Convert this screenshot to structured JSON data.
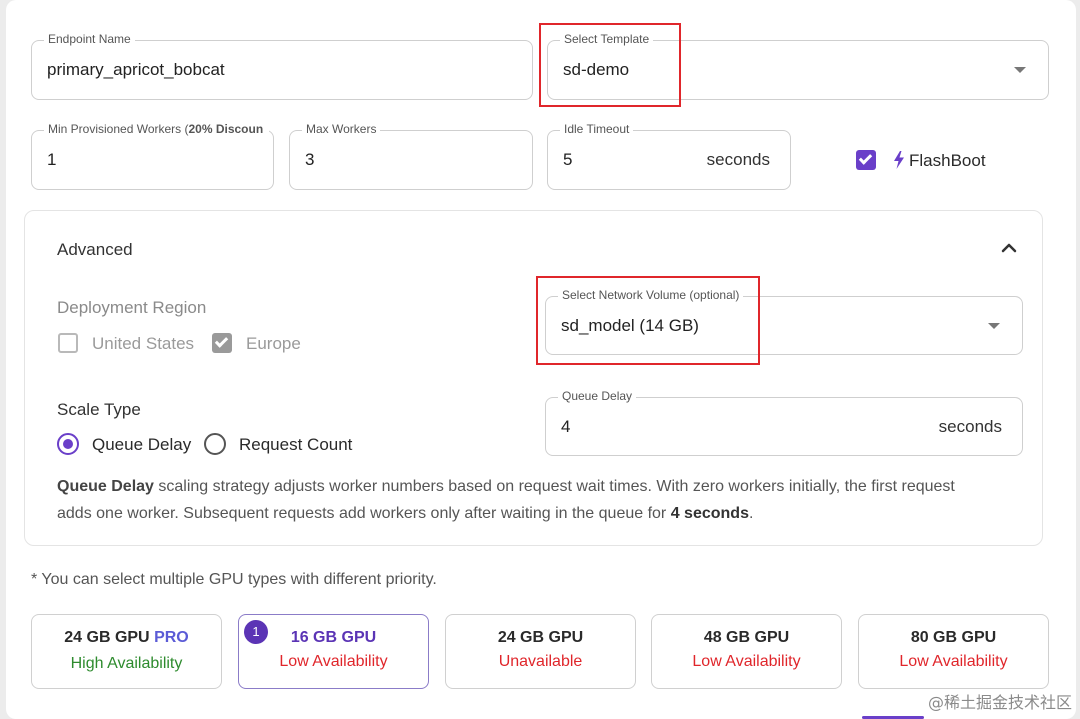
{
  "endpoint_name": {
    "label": "Endpoint Name",
    "value": "primary_apricot_bobcat"
  },
  "template": {
    "label": "Select Template",
    "value": "sd-demo"
  },
  "min_workers": {
    "label_prefix": "Min Provisioned Workers (",
    "label_bold": "20% Discoun",
    "value": "1"
  },
  "max_workers": {
    "label": "Max Workers",
    "value": "3"
  },
  "idle_timeout": {
    "label": "Idle Timeout",
    "value": "5",
    "unit": "seconds"
  },
  "flashboot": {
    "label": "FlashBoot",
    "checked": true,
    "icon": "lightning-icon"
  },
  "advanced": {
    "title": "Advanced",
    "deployment_region": {
      "label": "Deployment Region",
      "options": [
        {
          "label": "United States",
          "checked": false
        },
        {
          "label": "Europe",
          "checked": true
        }
      ]
    },
    "network_volume": {
      "label": "Select Network Volume (optional)",
      "value": "sd_model (14 GB)"
    },
    "scale_type": {
      "label": "Scale Type",
      "options": [
        {
          "label": "Queue Delay",
          "selected": true
        },
        {
          "label": "Request Count",
          "selected": false
        }
      ]
    },
    "queue_delay": {
      "label": "Queue Delay",
      "value": "4",
      "unit": "seconds"
    },
    "description": {
      "strong1": "Queue Delay",
      "text1": " scaling strategy adjusts worker numbers based on request wait times. With zero workers initially, the first request",
      "text2": "adds one worker. Subsequent requests add workers only after waiting in the queue for ",
      "strong2": "4 seconds",
      "text3": "."
    }
  },
  "gpu_note": "* You can select multiple GPU types with different priority.",
  "gpus": [
    {
      "title": "24 GB GPU",
      "badge_text": "PRO",
      "availability": "High Availability",
      "status": "high"
    },
    {
      "title": "16 GB GPU",
      "priority": "1",
      "availability": "Low Availability",
      "status": "low",
      "selected": true
    },
    {
      "title": "24 GB GPU",
      "availability": "Unavailable",
      "status": "unavailable"
    },
    {
      "title": "48 GB GPU",
      "availability": "Low Availability",
      "status": "low"
    },
    {
      "title": "80 GB GPU",
      "availability": "Low Availability",
      "status": "low"
    }
  ],
  "watermark": "@稀土掘金技术社区",
  "colors": {
    "accent": "#6a3fc9",
    "high": "#2e8b2e",
    "low": "#e0262b",
    "pro": "#5b5bd6",
    "highlight_box": "#e0262b"
  }
}
